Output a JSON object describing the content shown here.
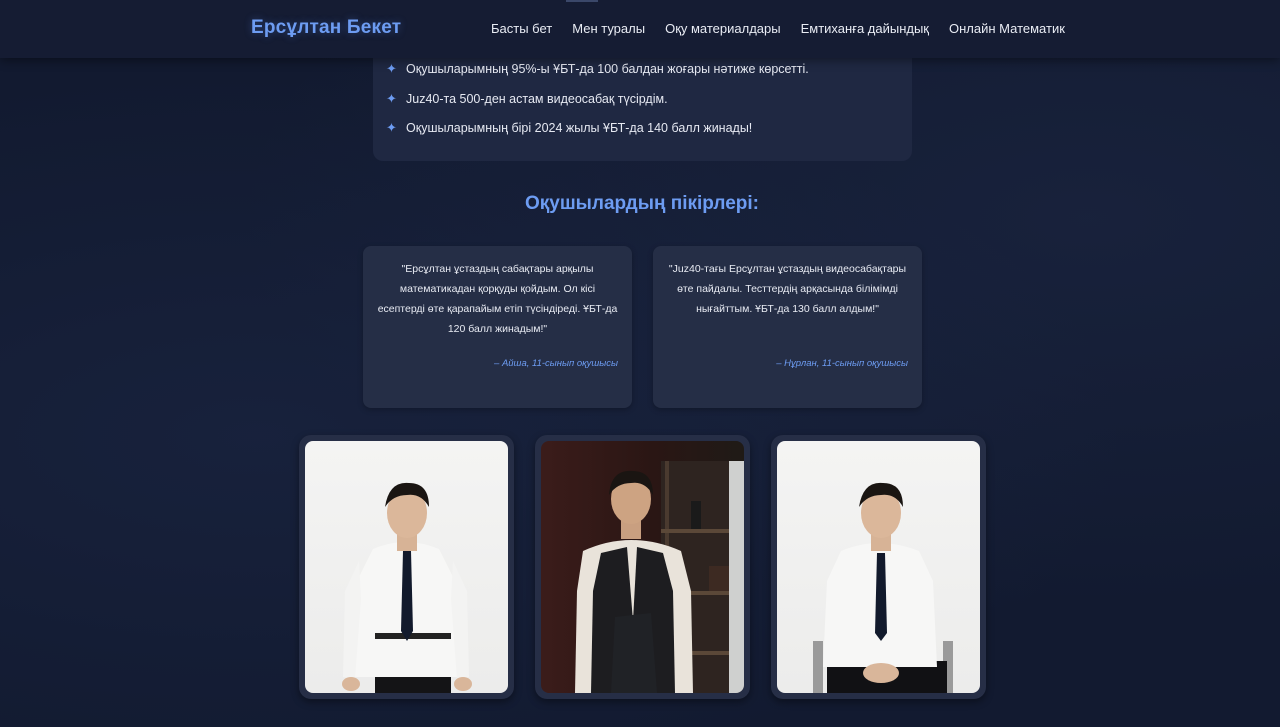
{
  "header": {
    "brand": "Ерсұлтан Бекет",
    "nav": [
      "Басты бет",
      "Мен туралы",
      "Оқу материалдары",
      "Емтиханға дайындық",
      "Онлайн Математик"
    ]
  },
  "achievements": {
    "items": [
      "Оқушыларымның 95%-ы ҰБТ-да 100 балдан жоғары нәтиже көрсетті.",
      "Juz40-та 500-ден астам видеосабақ түсірдім.",
      "Оқушыларымның бірі 2024 жылы ҰБТ-да 140 балл жинады!"
    ],
    "bullet_icon": "sparkle-icon"
  },
  "testimonials": {
    "title": "Оқушылардың пікірлері:",
    "items": [
      {
        "quote": "\"Ерсұлтан ұстаздың сабақтары арқылы математикадан қорқуды қойдым. Ол кісі есептерді өте қарапайым етіп түсіндіреді. ҰБТ-да 120 балл жинадым!\"",
        "author": "– Айша, 11-сынып оқушысы"
      },
      {
        "quote": "\"Juz40-тағы Ерсұлтан ұстаздың видеосабақтары өте пайдалы. Тесттердің арқасында білімімді нығайттым. ҰБТ-да 130 балл алдым!\"",
        "author": "– Нұрлан, 11-сынып оқушысы"
      }
    ]
  },
  "colors": {
    "accent": "#6d9cf2",
    "background": "#121a30",
    "card": "#252e46",
    "header": "#151c33"
  }
}
